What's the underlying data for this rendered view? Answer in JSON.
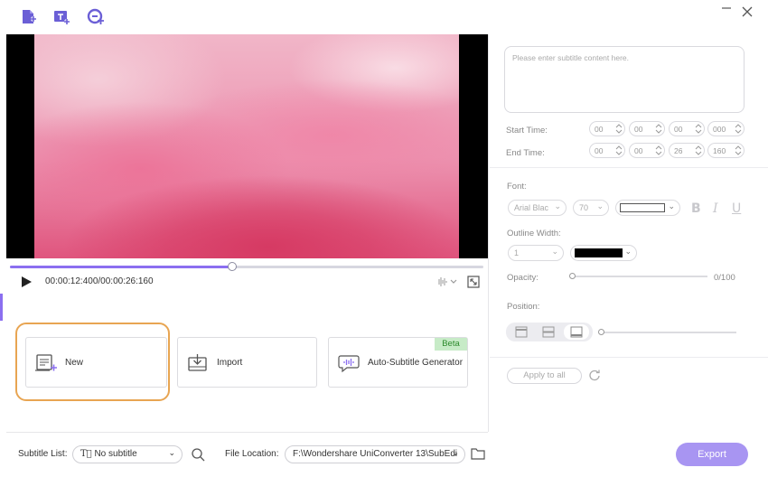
{
  "toolbar": {
    "icons": [
      "add-file-icon",
      "add-text-icon",
      "add-subtitle-icon"
    ]
  },
  "window": {
    "minimize_icon": "minimize-icon",
    "close_icon": "close-icon"
  },
  "player": {
    "timecode": "00:00:12:400/00:00:26:160",
    "progress": 0.47
  },
  "options": {
    "new_label": "New",
    "import_label": "Import",
    "auto_label": "Auto-Subtitle Generator",
    "beta_badge": "Beta"
  },
  "bottom": {
    "subtitle_list_label": "Subtitle List:",
    "subtitle_list_value": "No subtitle",
    "file_location_label": "File Location:",
    "file_location_value": "F:\\Wondershare UniConverter 13\\SubEdi",
    "export_label": "Export"
  },
  "editor": {
    "placeholder": "Please enter subtitle content here.",
    "start_time_label": "Start Time:",
    "start_time": [
      "00",
      "00",
      "00",
      "000"
    ],
    "end_time_label": "End Time:",
    "end_time": [
      "00",
      "00",
      "26",
      "160"
    ],
    "font_label": "Font:",
    "font_family": "Arial Blac",
    "font_size": "70",
    "outline_label": "Outline Width:",
    "outline_width": "1",
    "opacity_label": "Opacity:",
    "opacity_value": "0/100",
    "position_label": "Position:",
    "apply_all_label": "Apply to all"
  },
  "colors": {
    "accent": "#8b6ff0",
    "export_button": "#a895f2",
    "highlight_ring": "#e8a552",
    "beta_bg": "#c7ebc7"
  }
}
